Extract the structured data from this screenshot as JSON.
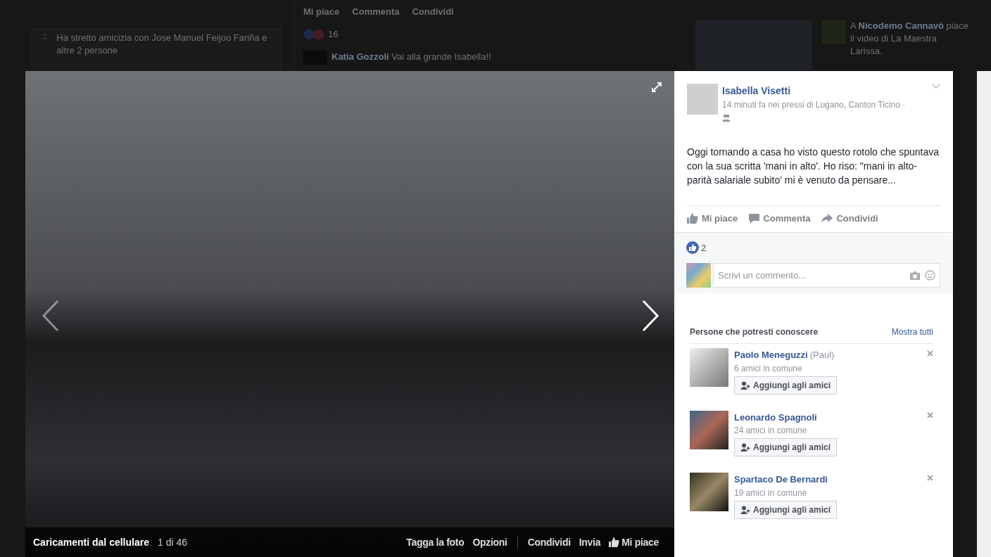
{
  "background_feed": {
    "activity": "Ha stretto amicizia con Jose Manuel Feijoo Fariña e altre 2 persone",
    "post_actions": [
      "Mi piace",
      "Commenta",
      "Condividi"
    ],
    "reaction_count": "16",
    "comment": "**Katia Gozzoli** Vai alla grande Isabella!!",
    "ticker": "A **Nicodemo Cannavò** piace il video di La Maestra Larissa."
  },
  "viewer": {
    "album": "Caricamenti dal cellulare",
    "position": "1 di 46",
    "actions_left": [
      "Tagga la foto",
      "Opzioni"
    ],
    "actions_right": [
      "Condividi",
      "Invia",
      "Mi piace"
    ]
  },
  "post": {
    "author": "Isabella Visetti",
    "meta": "14 minuti fa nei pressi di Lugano, Canton Ticino ·",
    "text": "Oggi tornando a casa ho visto questo rotolo che spuntava con la sua scritta 'mani in alto'. Ho riso: \"mani in alto-parità salariale subito' mi è venuto da pensare...",
    "actions": [
      "Mi piace",
      "Commenta",
      "Condividi"
    ],
    "likes": "2",
    "comment_placeholder": "Scrivi un commento..."
  },
  "suggestions": {
    "title": "Persone che potresti conoscere",
    "link": "Mostra tutti",
    "people": [
      {
        "name": "Paolo Meneguzzi",
        "alias": "(Paul)",
        "mutual": "6 amici in comune",
        "button": "Aggiungi agli amici"
      },
      {
        "name": "Leonardo Spagnoli",
        "mutual": "24 amici in comune",
        "button": "Aggiungi agli amici"
      },
      {
        "name": "Spartaco De Bernardi",
        "mutual": "19 amici in comune",
        "button": "Aggiungi agli amici"
      }
    ]
  }
}
